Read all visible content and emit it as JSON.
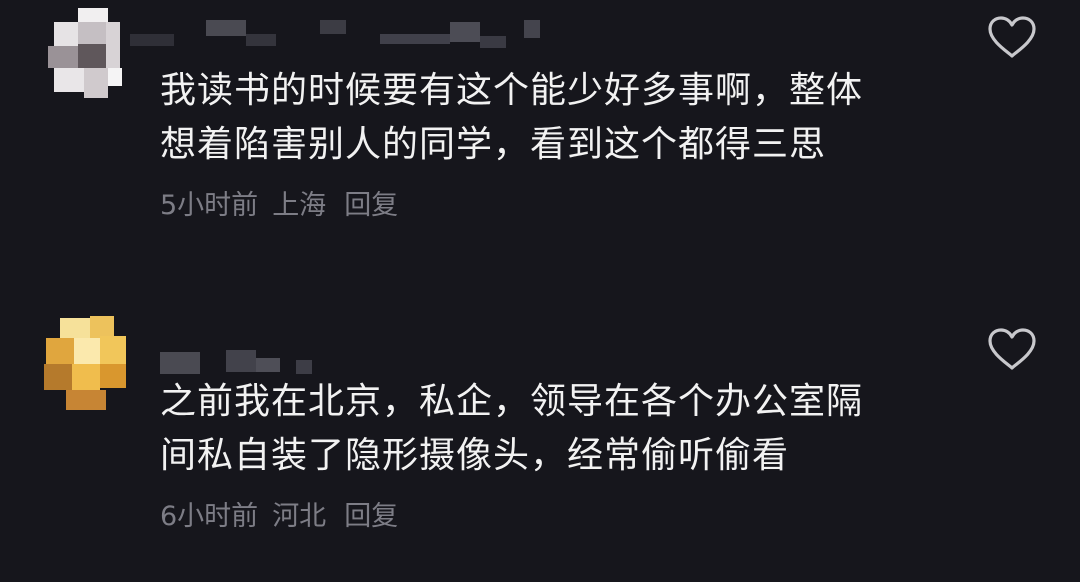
{
  "comments": [
    {
      "text_line1": "我读书的时候要有这个能少好多事啊，整体",
      "text_line2": "想着陷害别人的同学，看到这个都得三思",
      "time": "5小时前",
      "location": "上海",
      "reply_label": "回复",
      "avatar_colors": [
        "#e8e4e6",
        "#b9b3b8",
        "#6d6468",
        "#d6d0d4",
        "#8c8388"
      ]
    },
    {
      "text_line1": "之前我在北京，私企，领导在各个办公室隔",
      "text_line2": "间私自装了隐形摄像头，经常偷听偷看",
      "time": "6小时前",
      "location": "河北",
      "reply_label": "回复",
      "avatar_colors": [
        "#f4d58a",
        "#e9b24a",
        "#c98a2e",
        "#fbe7a6",
        "#a86d28"
      ]
    }
  ],
  "icons": {
    "like": "heart-outline-icon"
  },
  "colors": {
    "background": "#16161c",
    "text": "#f2f2f2",
    "meta": "#7d7d86",
    "icon": "#c8c8cc"
  }
}
